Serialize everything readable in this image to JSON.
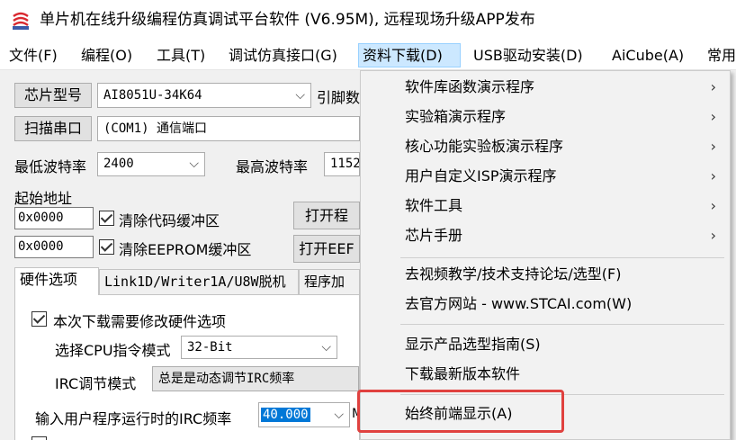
{
  "window": {
    "title": "单片机在线升级编程仿真调试平台软件 (V6.95M), 远程现场升级APP发布",
    "icon": "stc-logo-icon"
  },
  "menubar": [
    {
      "label": "文件(F)"
    },
    {
      "label": "编程(O)"
    },
    {
      "label": "工具(T)"
    },
    {
      "label": "调试仿真接口(G)"
    },
    {
      "label": "资料下载(D)",
      "active": true
    },
    {
      "label": "USB驱动安装(D)"
    },
    {
      "label": "AiCube(A)"
    },
    {
      "label": "常用"
    }
  ],
  "panel": {
    "chip_button": "芯片型号",
    "chip_value": "AI8051U-34K64",
    "pin_label": "引脚数",
    "scan_button": "扫描串口",
    "port_value": "(COM1) 通信端口",
    "min_baud_label": "最低波特率",
    "min_baud_value": "2400",
    "max_baud_label": "最高波特率",
    "max_baud_value": "1152",
    "start_addr_label": "起始地址",
    "addr1": "0x0000",
    "clear_code": "清除代码缓冲区",
    "open_btn1": "打开程",
    "addr2": "0x0000",
    "clear_eeprom": "清除EEPROM缓冲区",
    "open_btn2": "打开EEF"
  },
  "tabs": [
    {
      "label": "硬件选项",
      "active": true
    },
    {
      "label": "Link1D/Writer1A/U8W脱机"
    },
    {
      "label": "程序加"
    }
  ],
  "hardware": {
    "modify_option": "本次下载需要修改硬件选项",
    "cpu_mode_label": "选择CPU指令模式",
    "cpu_mode_value": "32-Bit",
    "irc_mode_label": "IRC调节模式",
    "irc_mode_value": "总是是动态调节IRC频率",
    "irc_freq_label": "输入用户程序运行时的IRC频率",
    "irc_freq_value": "40.000",
    "irc_unit": "M"
  },
  "dropdown": {
    "group1": [
      {
        "label": "软件库函数演示程序",
        "submenu": true
      },
      {
        "label": "实验箱演示程序",
        "submenu": true
      },
      {
        "label": "核心功能实验板演示程序",
        "submenu": true
      },
      {
        "label": "用户自定义ISP演示程序",
        "submenu": true
      },
      {
        "label": "软件工具",
        "submenu": true
      },
      {
        "label": "芯片手册",
        "submenu": true
      }
    ],
    "group2": [
      {
        "label": "去视频教学/技术支持论坛/选型(F)"
      },
      {
        "label": "去官方网站 - www.STCAI.com(W)"
      }
    ],
    "group3": [
      {
        "label": "显示产品选型指南(S)"
      },
      {
        "label": "下载最新版本软件"
      }
    ],
    "group4": [
      {
        "label": "始终前端显示(A)"
      }
    ],
    "submenu_arrow": "›"
  },
  "colors": {
    "menu_active_bg": "#cce8ff",
    "highlight_border": "#e0413f",
    "selection_bg": "#0078d7"
  }
}
